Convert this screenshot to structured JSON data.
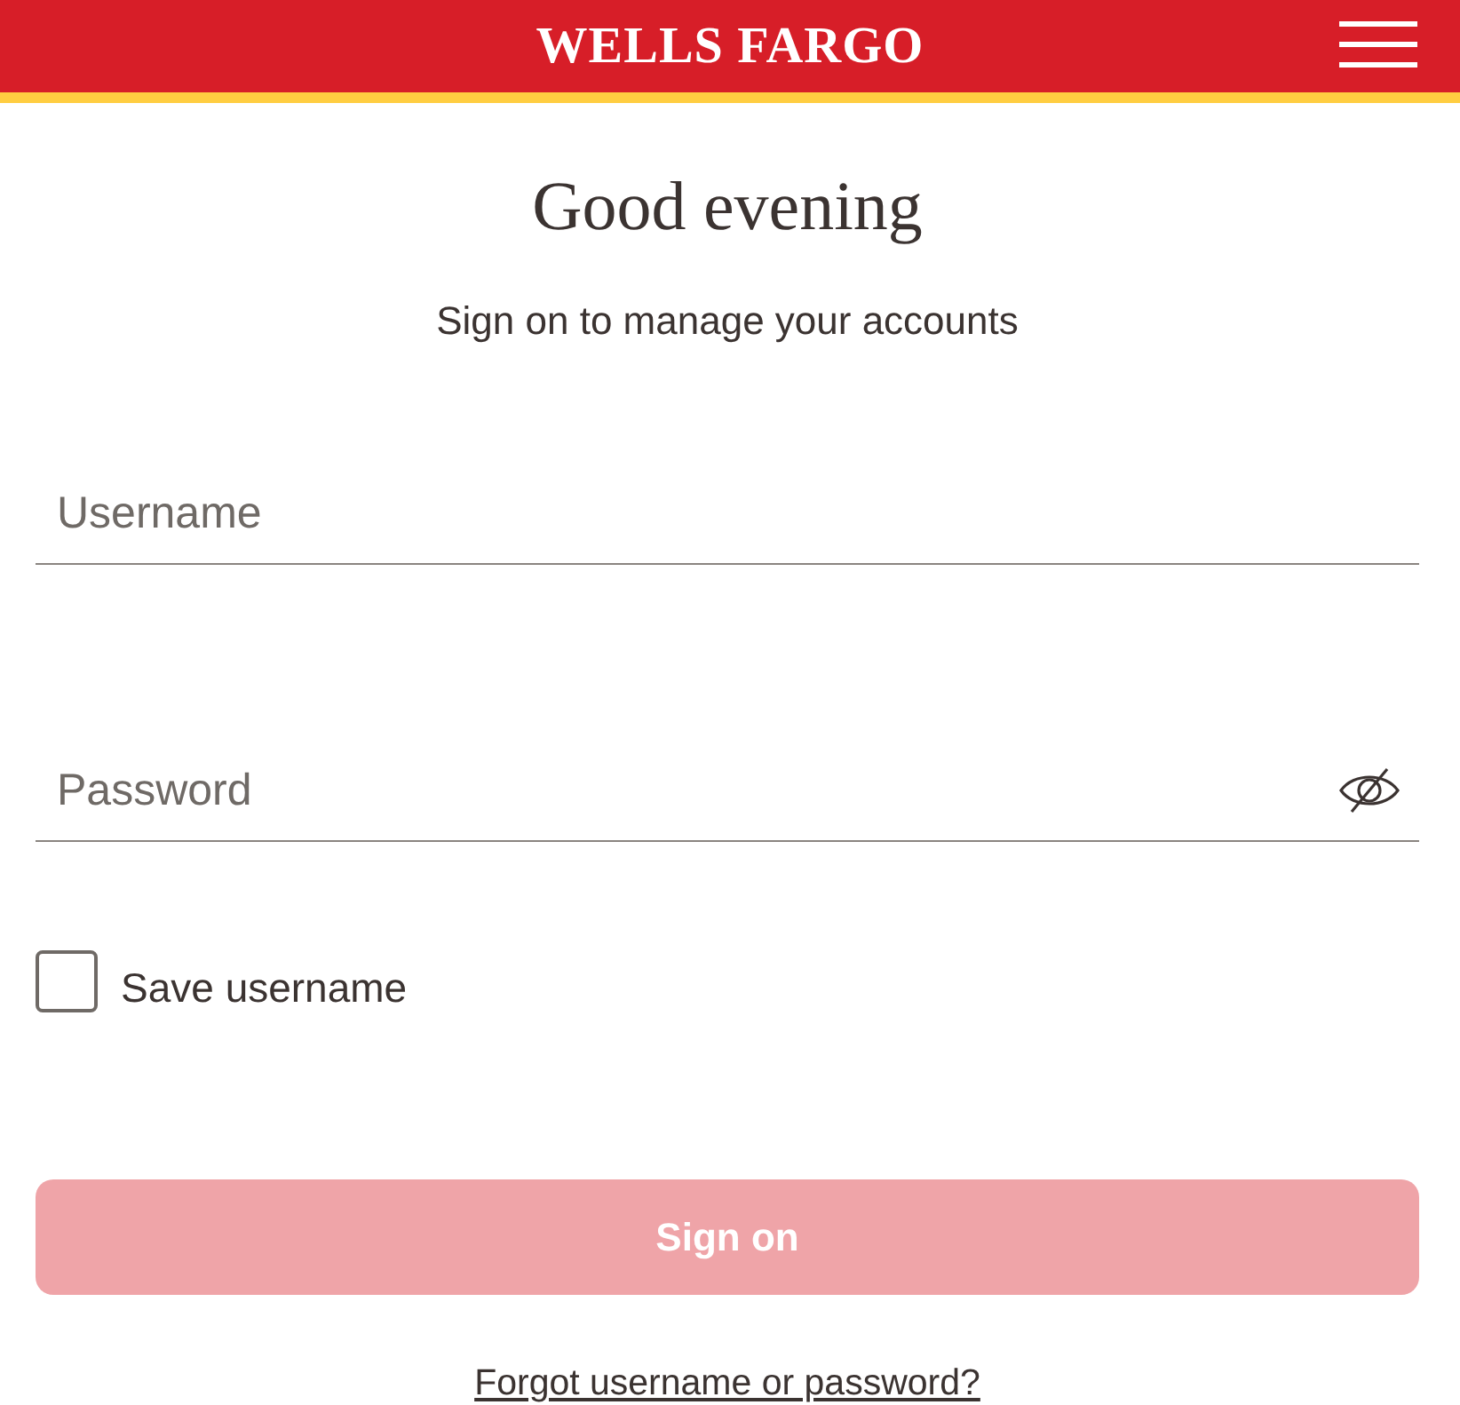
{
  "header": {
    "logo": "WELLS FARGO"
  },
  "greeting": "Good evening",
  "subtitle": "Sign on to manage your accounts",
  "fields": [
    {
      "kind": "text",
      "placeholder": "Username"
    },
    {
      "kind": "password",
      "placeholder": "Password",
      "password_visible": false
    }
  ],
  "save_username": {
    "label": "Save username",
    "checked": false
  },
  "sign_on_button": {
    "label": "Sign on",
    "disabled": true
  },
  "forgot_link": "Forgot username or password?"
}
